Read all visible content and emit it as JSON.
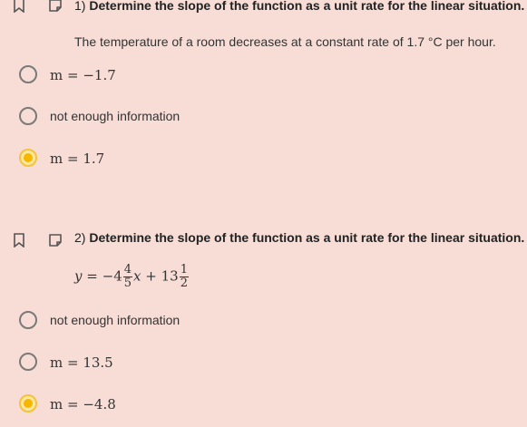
{
  "questions": [
    {
      "number": "1)",
      "title": "Determine the slope of the function as a unit rate for the linear situation.",
      "prompt": "The temperature of a room decreases at a constant rate of 1.7 °C per hour.",
      "options": [
        {
          "label": "m = −1.7",
          "selected": false
        },
        {
          "label": "not enough information",
          "selected": false
        },
        {
          "label": "m = 1.7",
          "selected": true
        }
      ]
    },
    {
      "number": "2)",
      "title": "Determine the slope of the function as a unit rate for the linear situation.",
      "equation": {
        "lhs": "y",
        "eq": "=",
        "sign1": "−",
        "whole1": "4",
        "frac1_num": "4",
        "frac1_den": "5",
        "var": "x",
        "sign2": "+",
        "whole2": "13",
        "frac2_num": "1",
        "frac2_den": "2"
      },
      "options": [
        {
          "label": "not enough information",
          "selected": false
        },
        {
          "label": "m = 13.5",
          "selected": false
        },
        {
          "label": "m = −4.8",
          "selected": true
        }
      ]
    }
  ],
  "colors": {
    "background": "#f7ddd6",
    "selected_radio": "#f5b700",
    "unselected_radio": "#7a7a7a"
  }
}
